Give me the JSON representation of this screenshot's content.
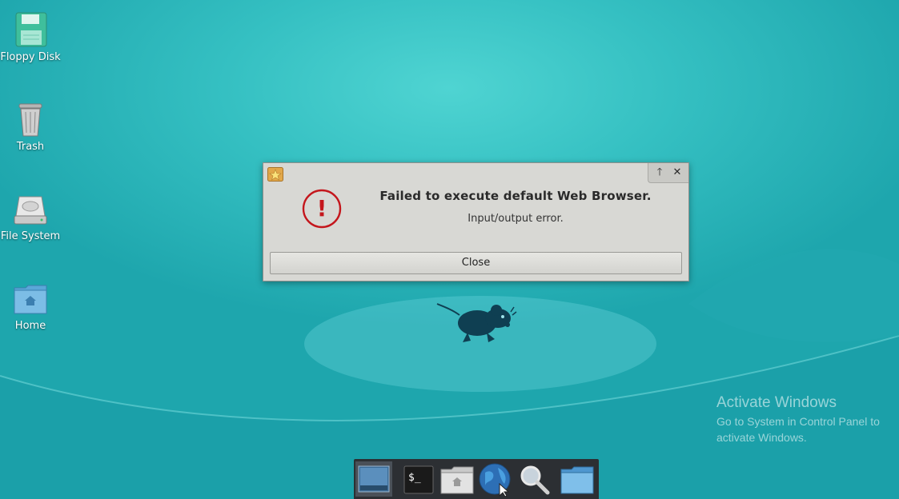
{
  "desktop": {
    "icons": [
      {
        "label": "Floppy Disk",
        "icon": "floppy-disk-icon"
      },
      {
        "label": "Trash",
        "icon": "trash-icon"
      },
      {
        "label": "File System",
        "icon": "hard-drive-icon"
      },
      {
        "label": "Home",
        "icon": "home-folder-icon"
      }
    ]
  },
  "dialog": {
    "title": "Failed to execute default Web Browser.",
    "message": "Input/output error.",
    "close_label": "Close",
    "maximize_glyph": "🡑",
    "close_glyph": "✕",
    "error_glyph": "!",
    "error_color": "#c4161c"
  },
  "watermark": {
    "title": "Activate Windows",
    "subtitle": "Go to System in Control Panel to activate Windows."
  },
  "taskbar": {
    "items": [
      {
        "name": "show-desktop",
        "icon": "show-desktop-icon"
      },
      {
        "name": "terminal",
        "icon": "terminal-icon",
        "text": "$_"
      },
      {
        "name": "file-manager",
        "icon": "home-folder-icon"
      },
      {
        "name": "web-browser",
        "icon": "globe-icon"
      },
      {
        "name": "app-finder",
        "icon": "magnifier-icon"
      },
      {
        "name": "folder",
        "icon": "folder-icon"
      }
    ]
  },
  "colors": {
    "background": "#2fbcc0",
    "taskbar": "#2c2f33",
    "dialog": "#d8d8d4"
  }
}
